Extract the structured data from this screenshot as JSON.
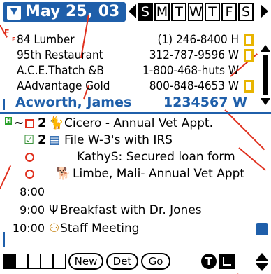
{
  "header": {
    "date": "May 25, 03",
    "days": [
      "S",
      "M",
      "T",
      "W",
      "T",
      "F",
      "S"
    ],
    "selected_day_index": 0
  },
  "markers": {
    "f_top": "F",
    "f_mid": "F"
  },
  "phones": [
    {
      "name": "84 Lumber",
      "number": "(1) 246-8400 H"
    },
    {
      "name": "95th Restaurant",
      "number": "312-787-9596 W"
    },
    {
      "name": "A.C.E.Thatch &B",
      "number": "1-800-468-huts W"
    },
    {
      "name": "AAdvantage Gold",
      "number": "800-848-4653 W"
    }
  ],
  "phone_selected": {
    "name": "Acworth, James",
    "number": "1234567 W"
  },
  "agenda": [
    {
      "time": "",
      "prefix": "~",
      "priority": "2",
      "text": "Cicero - Annual Vet Appt."
    },
    {
      "time": "",
      "prefix": "",
      "priority": "2",
      "text": "File W-3's with IRS"
    },
    {
      "time": "",
      "prefix": "",
      "priority": "",
      "text": "KathyS: Secured loan form"
    },
    {
      "time": "",
      "prefix": "",
      "priority": "",
      "text": "Limbe, Mali- Annual Vet Appt"
    },
    {
      "time": "8:00",
      "prefix": "",
      "priority": "",
      "text": ""
    },
    {
      "time": "9:00",
      "prefix": "",
      "priority": "",
      "text": "Breakfast with Dr. Jones"
    },
    {
      "time": "10:00",
      "prefix": "",
      "priority": "",
      "text": "Staff Meeting"
    }
  ],
  "toolbar": {
    "new": "New",
    "det": "Det",
    "go": "Go",
    "t": "T"
  },
  "green_marker": "H",
  "colors": {
    "accent_blue": "#1f5faa",
    "marker_red": "#e0301e",
    "flag_yellow": "#e8b400",
    "check_green": "#2a8a2a"
  }
}
